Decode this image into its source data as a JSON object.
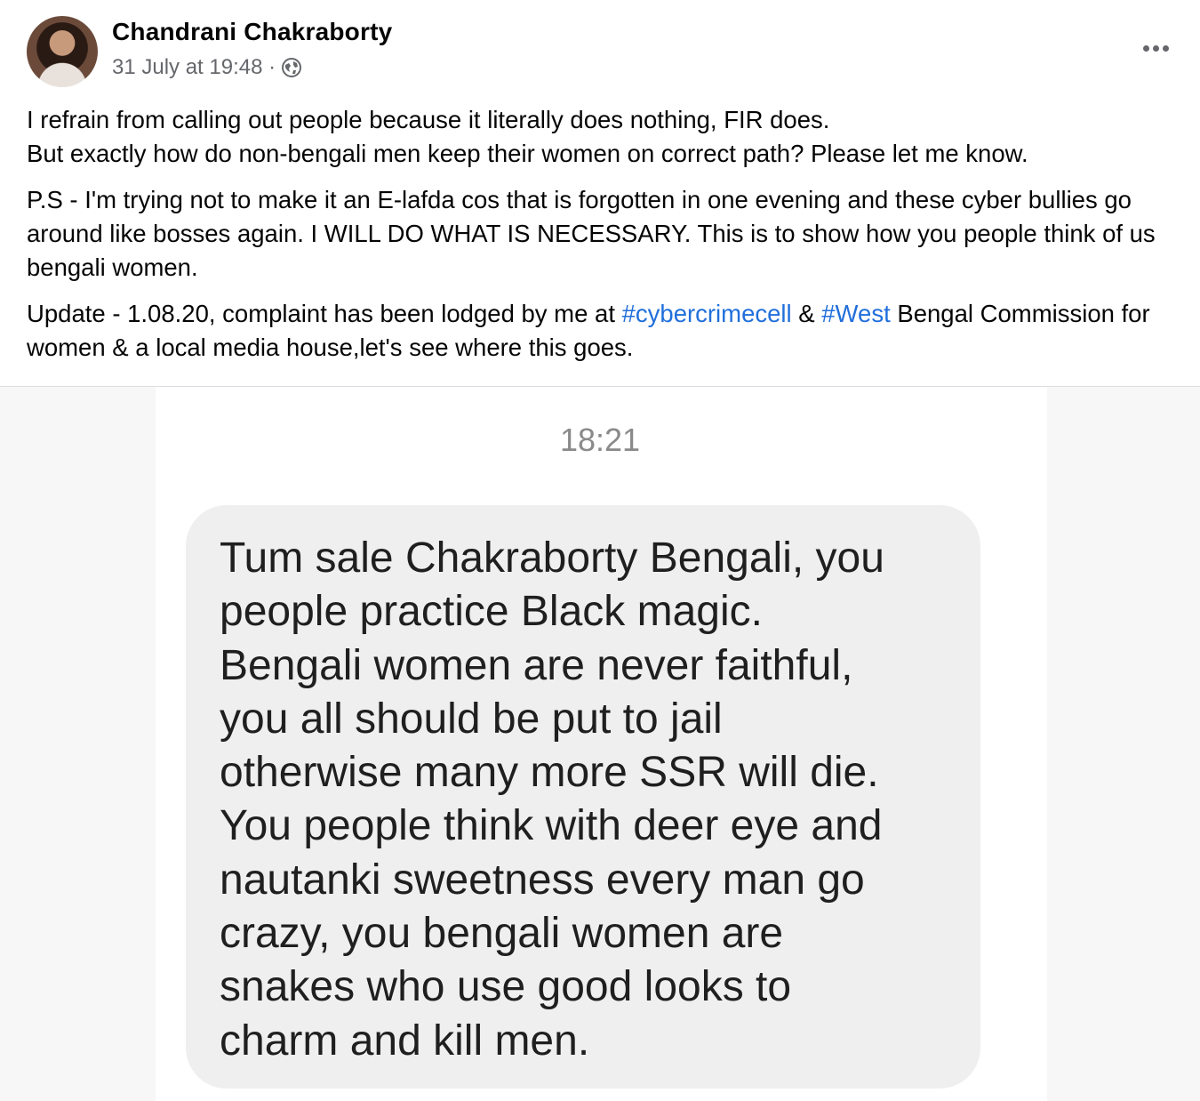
{
  "post": {
    "author": "Chandrani Chakraborty",
    "timestamp": "31 July at 19:48 ·",
    "privacy_icon": "globe-icon",
    "more_icon": "more-options-icon",
    "paragraph1_line1": "I refrain from calling out people because it literally does nothing, FIR does.",
    "paragraph1_line2": "But exactly how do non-bengali men keep their women on correct path? Please let me know.",
    "paragraph2": "P.S - I'm trying not to make it an E-lafda cos that is forgotten in one evening and these cyber bullies go around like bosses again. I WILL DO WHAT IS NECESSARY. This is to show how you people think of us bengali women.",
    "paragraph3_start": "Update - 1.08.20, complaint has been lodged by me at ",
    "hashtag1": "#cybercrimecell",
    "paragraph3_mid": " & ",
    "hashtag2": "#West",
    "paragraph3_end": " Bengal Commission for women & a local media house,let's see where this goes."
  },
  "screenshot": {
    "time": "18:21",
    "message_lines": [
      "Tum sale Chakraborty Bengali, you",
      "people practice Black magic.",
      "Bengali women are never faithful,",
      "you all should be put to jail",
      "otherwise many more SSR will die.",
      "You people think with deer eye and",
      "nautanki sweetness every man go",
      "crazy, you bengali women are",
      "snakes who use good looks to",
      "charm and kill men."
    ]
  }
}
